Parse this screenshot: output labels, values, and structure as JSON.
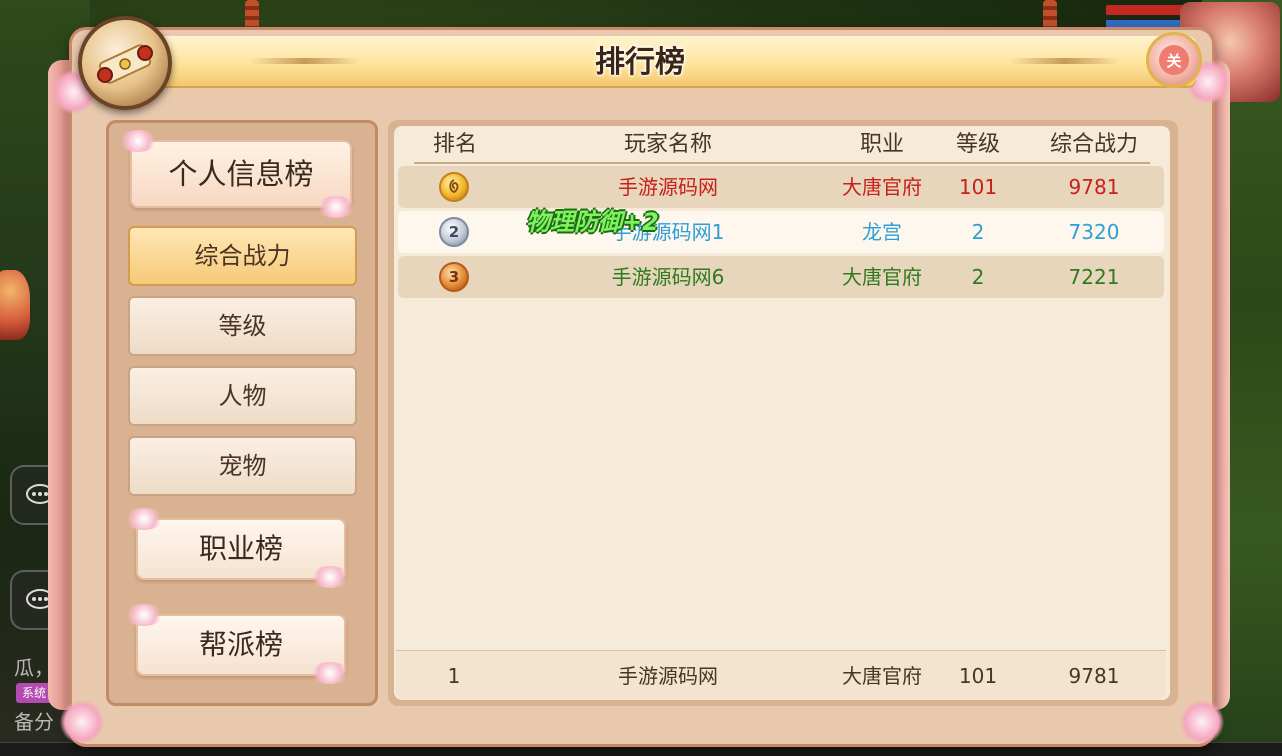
{
  "dialog": {
    "title": "排行榜",
    "close_icon_label": "关"
  },
  "categories": {
    "personal": "个人信息榜",
    "job": "职业榜",
    "guild": "帮派榜"
  },
  "sub_tabs": [
    {
      "label": "综合战力",
      "active": true
    },
    {
      "label": "等级",
      "active": false
    },
    {
      "label": "人物",
      "active": false
    },
    {
      "label": "宠物",
      "active": false
    }
  ],
  "table": {
    "headers": [
      "排名",
      "玩家名称",
      "职业",
      "等级",
      "综合战力"
    ],
    "rows": [
      {
        "rank": "1",
        "name": "手游源码网",
        "job": "大唐官府",
        "level": "101",
        "power": "9781",
        "color": "#c8201a"
      },
      {
        "rank": "2",
        "name": "手游源码网1",
        "job": "龙宫",
        "level": "2",
        "power": "7320",
        "color": "#2d9fd6"
      },
      {
        "rank": "3",
        "name": "手游源码网6",
        "job": "大唐官府",
        "level": "2",
        "power": "7221",
        "color": "#2f7a1e"
      }
    ],
    "my_row": {
      "rank": "1",
      "name": "手游源码网",
      "job": "大唐官府",
      "level": "101",
      "power": "9781"
    }
  },
  "floating_text": "物理防御+2",
  "hud": {
    "chat_line_1": "瓜，",
    "chat_line_2": "备分",
    "system_tag": "系统"
  },
  "icons": {
    "emblem": "scroll-emblem-icon",
    "close": "close-icon",
    "rank_1": "gold-medal-icon",
    "rank_2": "silver-medal-icon",
    "rank_3": "bronze-medal-icon",
    "chat": "chat-bubble-icon"
  },
  "colors": {
    "rank1_text": "#c8201a",
    "rank2_text": "#2d9fd6",
    "rank3_text": "#2f7a1e",
    "active_tab": "#f6c977"
  }
}
